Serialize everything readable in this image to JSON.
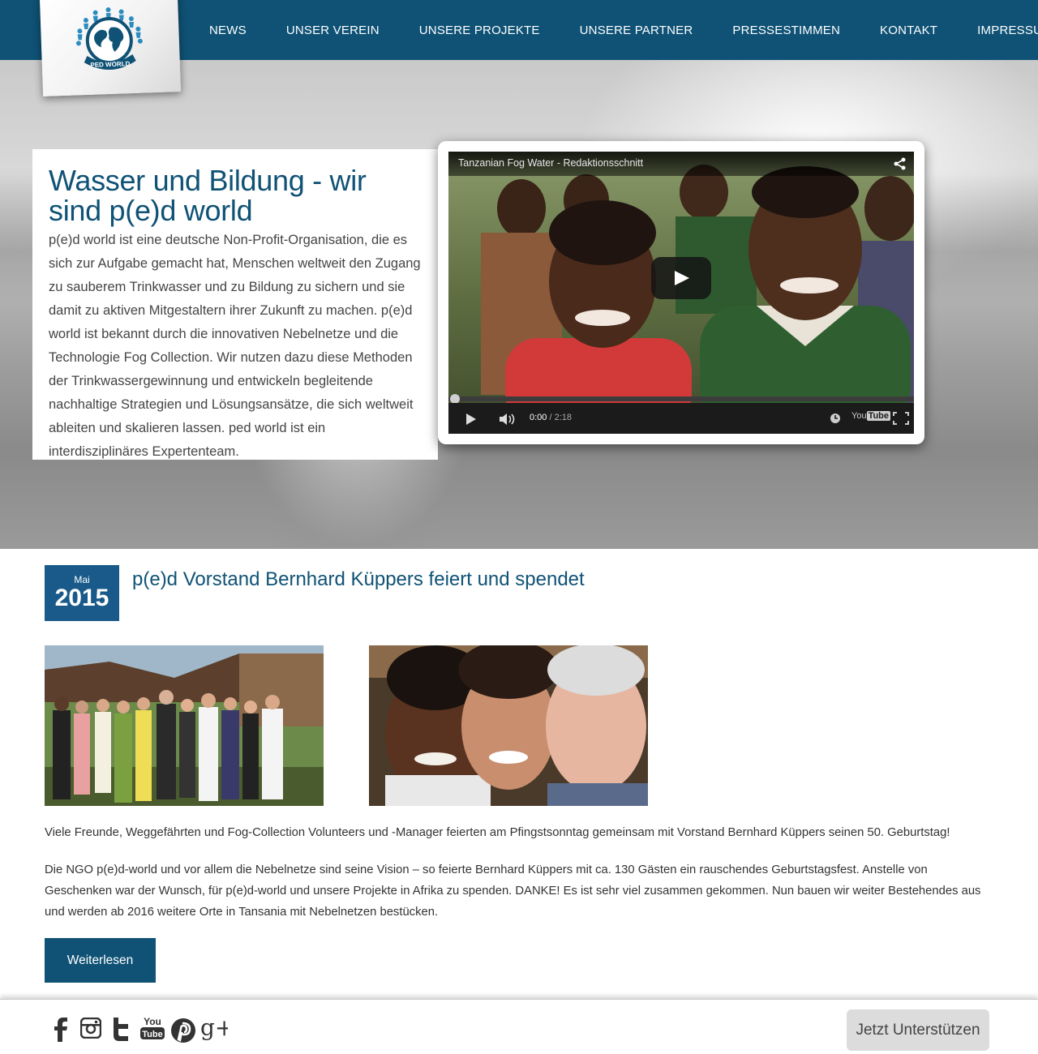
{
  "brand": {
    "logo_text": "PED WORLD",
    "primary_color": "#0f5275",
    "date_color": "#195a8a"
  },
  "nav": {
    "items": [
      {
        "label": "NEWS"
      },
      {
        "label": "UNSER VEREIN"
      },
      {
        "label": "UNSERE PROJEKTE"
      },
      {
        "label": "UNSERE PARTNER"
      },
      {
        "label": "PRESSESTIMMEN"
      },
      {
        "label": "KONTAKT"
      },
      {
        "label": "IMPRESSUM"
      }
    ]
  },
  "hero": {
    "title": "Wasser und Bildung - wir sind p(e)d world",
    "body": "p(e)d world ist eine deutsche Non-Profit-Organisation, die es sich zur Aufgabe gemacht hat, Menschen weltweit den Zugang zu sauberem Trinkwasser und zu Bildung zu sichern und sie damit zu aktiven Mitgestaltern ihrer Zukunft zu machen. p(e)d world ist bekannt durch die innovativen Nebelnetze und die Technologie Fog Collection. Wir nutzen dazu diese Methoden der Trinkwassergewinnung und entwickeln begleitende nachhaltige Strategien und Lösungsansätze, die sich weltweit ableiten und skalieren lassen. ped world ist ein interdisziplinäres Expertenteam."
  },
  "video": {
    "title": "Tanzanian Fog Water - Redaktionsschnitt",
    "current_time": "0:00",
    "duration": "/ 2:18",
    "progress": 0,
    "youtube_badge_you": "You",
    "youtube_badge_tube": "Tube",
    "icons": [
      "share-icon",
      "play-icon",
      "volume-icon",
      "clock-icon",
      "fullscreen-icon"
    ]
  },
  "post": {
    "month": "Mai",
    "year": "2015",
    "title": "p(e)d Vorstand Bernhard Küppers feiert und spendet",
    "paragraph_1": "Viele Freunde, Weggefährten und Fog-Collection Volunteers und -Manager feierten am Pfingstsonntag gemeinsam mit Vorstand Bernhard Küppers seinen 50. Geburtstag!",
    "paragraph_2": "Die NGO p(e)d-world und vor allem die Nebelnetze sind seine Vision – so feierte Bernhard Küppers mit ca. 130 Gästen ein rauschendes Geburtstagsfest. Anstelle von Geschenken war der Wunsch, für p(e)d-world und unsere Projekte in Afrika zu spenden. DANKE! Es ist sehr viel zusammen gekommen. Nun bauen wir weiter Bestehendes aus und werden ab 2016 weitere Orte in Tansania mit Nebelnetzen bestücken.",
    "read_more_label": "Weiterlesen"
  },
  "footer": {
    "social_icons": [
      "facebook-icon",
      "instagram-icon",
      "twitter-icon",
      "youtube-icon",
      "pinterest-icon",
      "googleplus-icon"
    ],
    "youtube_icon_you": "You",
    "youtube_icon_tube": "Tube",
    "googleplus_text": "g+",
    "support_label": "Jetzt Unterstützen"
  }
}
